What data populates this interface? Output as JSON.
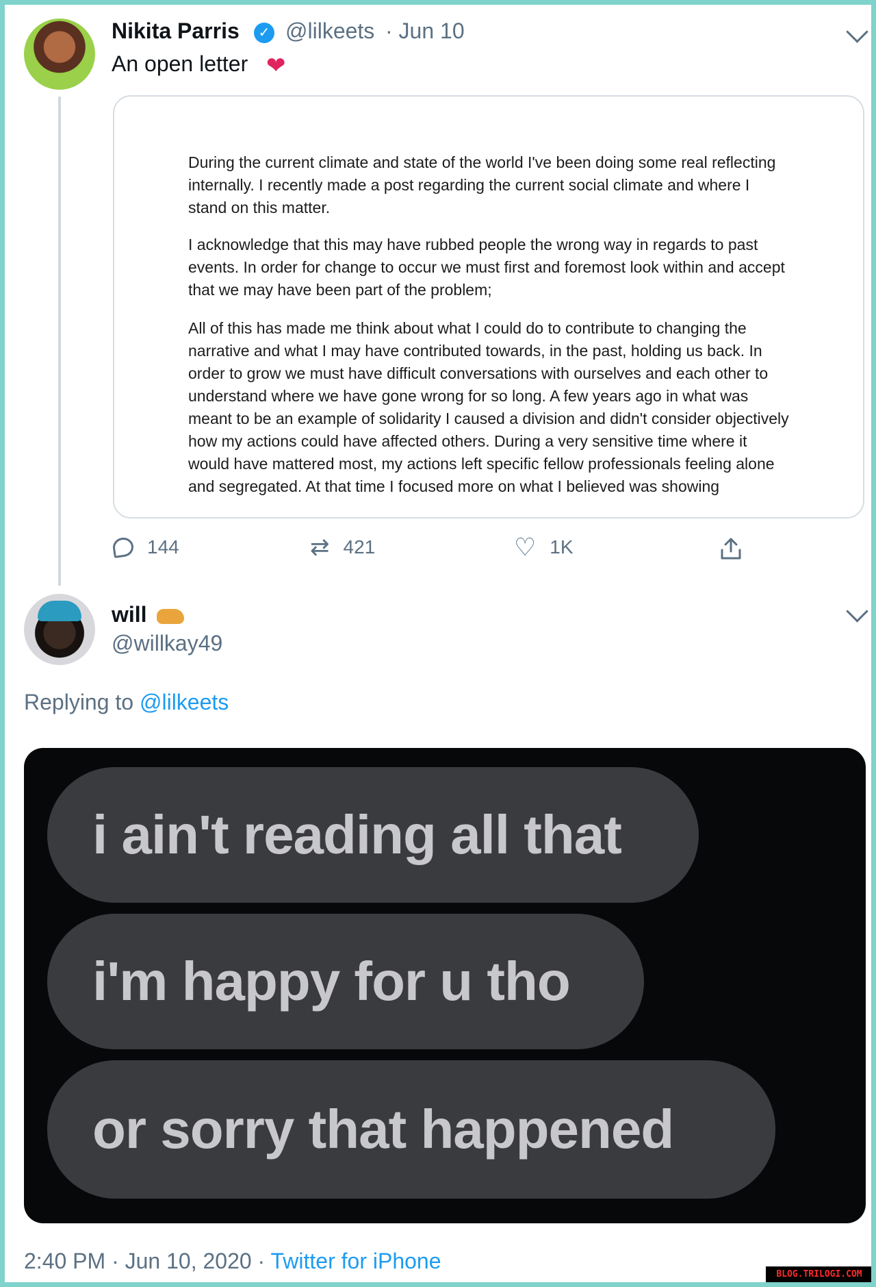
{
  "tweet": {
    "author_name": "Nikita Parris",
    "handle": "@lilkeets",
    "date": "· Jun 10",
    "text": "An open letter",
    "letter_paragraphs": [
      "During the current climate and state of the world I've been doing some real reflecting internally. I recently made a post regarding the current social climate and where I stand on this matter.",
      "I acknowledge that this may have rubbed people the wrong way in regards to past events. In order for change to occur we must first and foremost look within and accept that we may have been part of the problem;",
      "All of this has made me think about what I could do to contribute to changing the narrative and what I may have contributed towards, in the past, holding us back. In order to grow we must have difficult conversations with ourselves and each other to understand where we have gone wrong for so long. A few years ago in what was meant to be an example of solidarity I caused a division and didn't consider objectively how my actions could have affected others. During a very sensitive time where it would have mattered most, my actions left specific fellow professionals feeling alone and segregated. At that time I focused more on what I believed was showing"
    ],
    "stats": {
      "replies": "144",
      "retweets": "421",
      "likes": "1K"
    }
  },
  "reply": {
    "author_name": "will",
    "handle": "@willkay49",
    "replying_prefix": "Replying to",
    "replying_to": "@lilkeets",
    "image_bubbles": [
      "i ain't reading all that",
      "i'm happy for u tho",
      "or sorry that happened"
    ],
    "timestamp": "2:40 PM · Jun 10, 2020 ·",
    "source": "Twitter for iPhone"
  },
  "watermark": "BLOG.TRILOGI.COM",
  "colors": {
    "link": "#1d9bf0",
    "secondary_text": "#5b7083",
    "frame_border": "#7fd3cc",
    "bubble": "#3a3b3f"
  },
  "icons": [
    "chevron-down-icon",
    "verified-badge-icon",
    "heart-emoji",
    "reply-icon",
    "retweet-icon",
    "like-icon",
    "share-icon",
    "cow-emoji"
  ]
}
